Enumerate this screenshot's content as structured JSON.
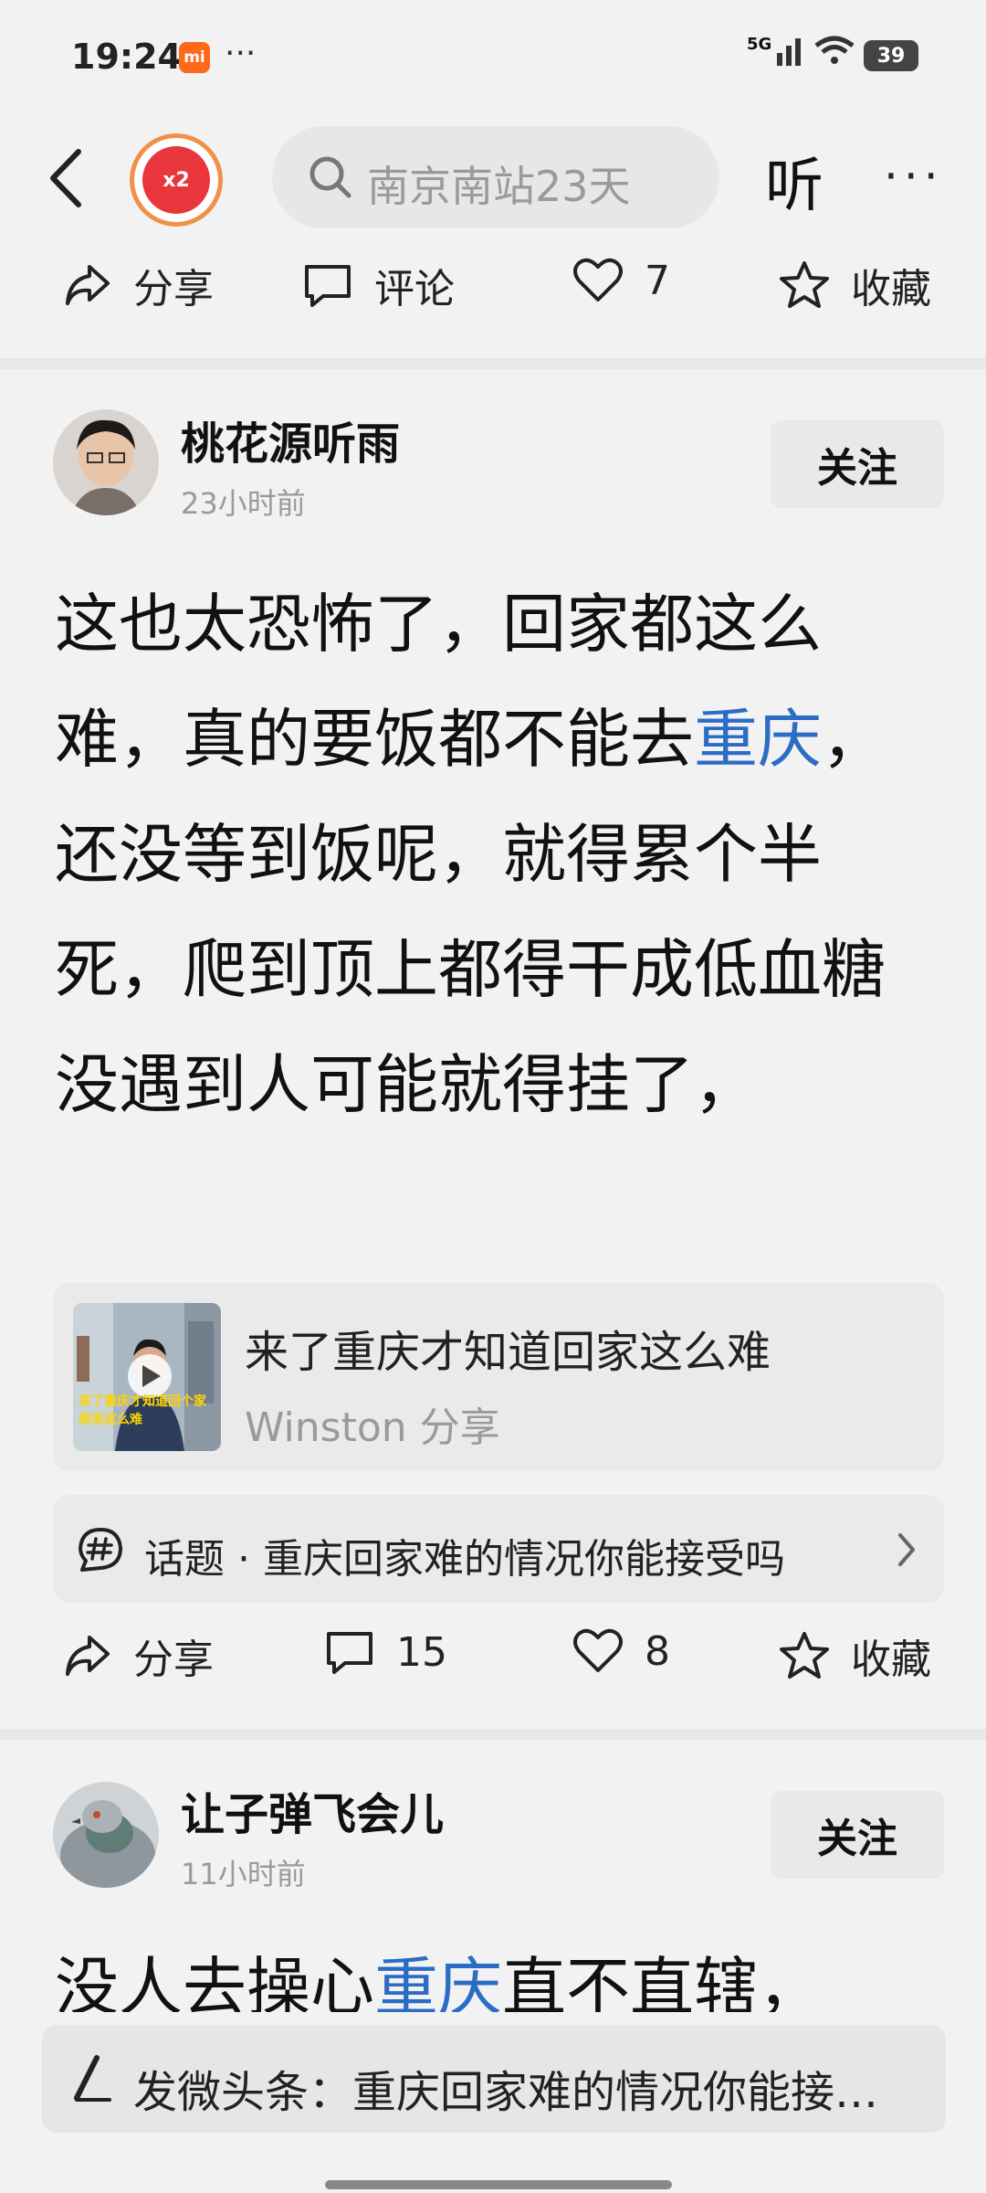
{
  "status_bar": {
    "time": "19:24",
    "mi_badge": "mi",
    "more_dots": "···",
    "network": "5G",
    "battery": "39"
  },
  "top_nav": {
    "redpacket_label": "x2",
    "search_placeholder": "南京南站23天",
    "listen_label": "听",
    "more_label": "···"
  },
  "top_actions": {
    "share": "分享",
    "comment": "评论",
    "likes": "7",
    "favorite": "收藏"
  },
  "post1": {
    "username": "桃花源听雨",
    "time": "23小时前",
    "follow": "关注",
    "text_before": "这也太恐怖了，回家都这么难，真的要饭都不能去",
    "link": "重庆",
    "text_after": "，还没等到饭呢，就得累个半死，爬到顶上都得干成低血糖没遇到人可能就得挂了，",
    "card": {
      "thumb_caption": "来了重庆才知道回个家原来这么难",
      "title": "来了重庆才知道回家这么难",
      "source": "Winston 分享"
    },
    "topic": {
      "label": "话题",
      "separator": "·",
      "text": "重庆回家难的情况你能接受吗"
    },
    "actions": {
      "share": "分享",
      "comments": "15",
      "likes": "8",
      "favorite": "收藏"
    }
  },
  "post2": {
    "username": "让子弹飞会儿",
    "time": "11小时前",
    "follow": "关注",
    "text_before": "没人去操心",
    "link": "重庆",
    "text_after": "直不直辖，"
  },
  "compose_bar": {
    "text": "发微头条：重庆回家难的情况你能接受吗"
  },
  "colors": {
    "link": "#2b6cc4",
    "background": "#f2f2f2",
    "muted": "#9a9a9a"
  }
}
